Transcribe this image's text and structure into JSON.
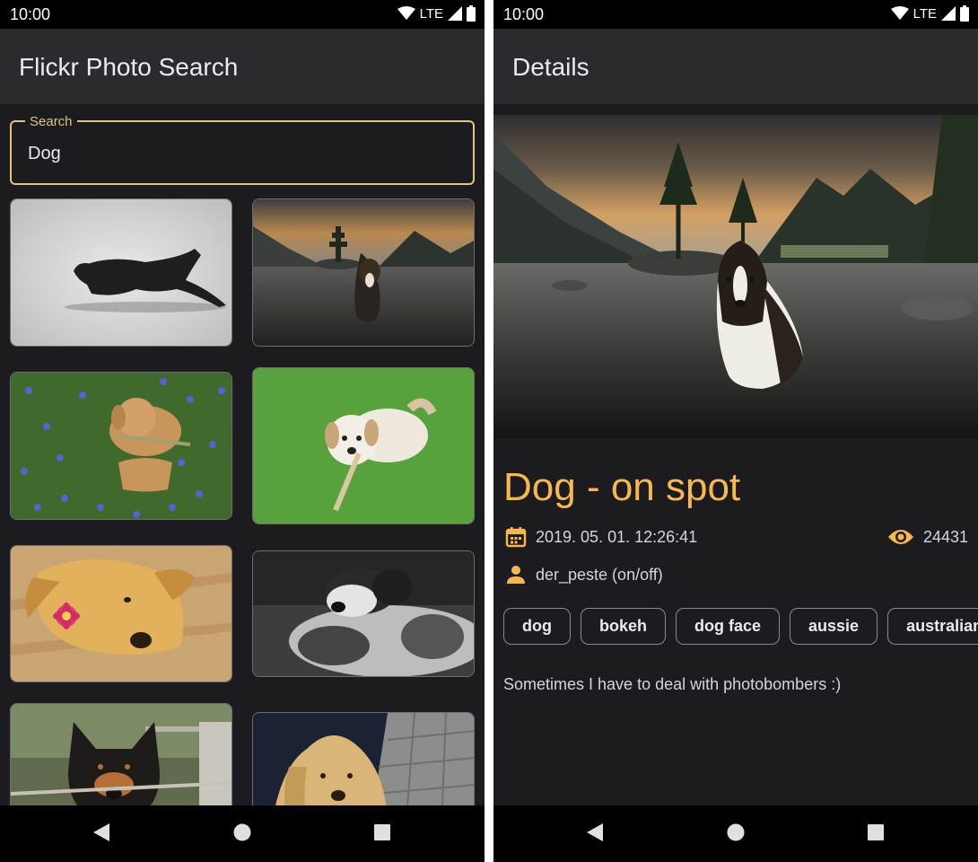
{
  "status": {
    "time": "10:00",
    "network": "LTE"
  },
  "search_screen": {
    "title": "Flickr Photo Search",
    "search": {
      "label": "Search",
      "value": "Dog"
    },
    "photos": [
      {
        "alt": "dog-running-photo"
      },
      {
        "alt": "dog-in-lake-photo"
      },
      {
        "alt": "dog-in-bluebells-photo"
      },
      {
        "alt": "dog-with-stick-photo"
      },
      {
        "alt": "dog-with-flower-photo"
      },
      {
        "alt": "dog-sleeping-bw-photo"
      },
      {
        "alt": "dog-portrait-photo"
      },
      {
        "alt": "shaggy-dog-photo"
      }
    ]
  },
  "details_screen": {
    "title": "Details",
    "photo_title": "Dog - on spot",
    "date": "2019. 05. 01. 12:26:41",
    "views": "24431",
    "owner": "der_peste (on/off)",
    "tags": [
      "dog",
      "bokeh",
      "dog face",
      "aussie",
      "australian s"
    ],
    "description": "Sometimes I have to deal with photobombers :)"
  },
  "colors": {
    "accent": "#f7b84c",
    "search_outline": "#e2c47a",
    "background": "#1c1b20",
    "appbar": "#2b2a2e"
  }
}
